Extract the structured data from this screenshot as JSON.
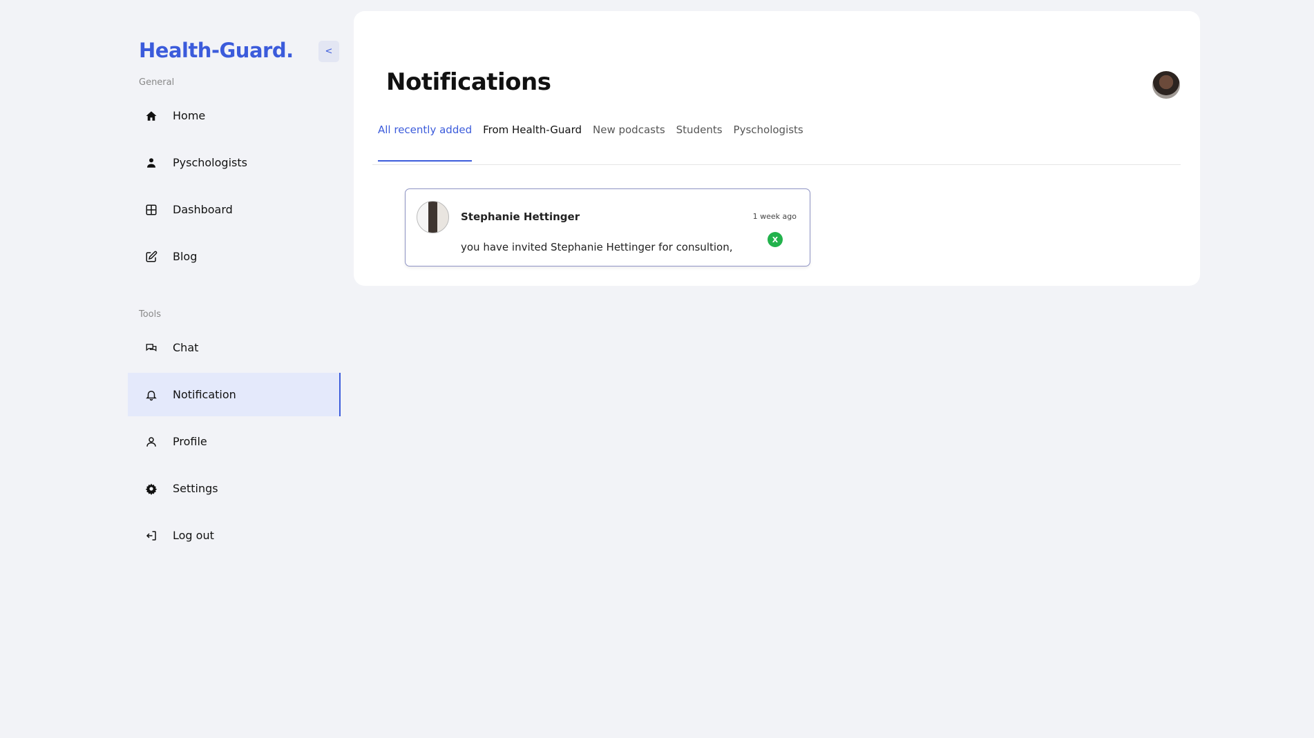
{
  "app": {
    "logo": "Health-Guard.",
    "collapse_label": "<"
  },
  "sidebar": {
    "general_label": "General",
    "tools_label": "Tools",
    "general_items": [
      {
        "label": "Home",
        "icon": "home-icon"
      },
      {
        "label": "Pyschologists",
        "icon": "person-icon"
      },
      {
        "label": "Dashboard",
        "icon": "grid-icon"
      },
      {
        "label": "Blog",
        "icon": "edit-icon"
      }
    ],
    "tools_items": [
      {
        "label": "Chat",
        "icon": "chat-icon"
      },
      {
        "label": "Notification",
        "icon": "bell-icon",
        "active": true
      },
      {
        "label": "Profile",
        "icon": "user-icon"
      },
      {
        "label": "Settings",
        "icon": "gear-icon"
      },
      {
        "label": "Log out",
        "icon": "logout-icon"
      }
    ]
  },
  "main": {
    "title": "Notifications",
    "tabs": [
      {
        "label": "All recently added",
        "active": true
      },
      {
        "label": "From Health-Guard"
      },
      {
        "label": "New podcasts"
      },
      {
        "label": "Students"
      },
      {
        "label": "Pyschologists"
      }
    ],
    "notifications": [
      {
        "name": "Stephanie Hettinger",
        "time": "1 week ago",
        "message": "you have invited Stephanie Hettinger for consultion,",
        "dismiss_label": "X"
      }
    ]
  },
  "colors": {
    "accent": "#3b5bdb",
    "background": "#f2f3f7",
    "active_nav_bg": "#e4e9fb",
    "dismiss_green": "#22b24c"
  }
}
